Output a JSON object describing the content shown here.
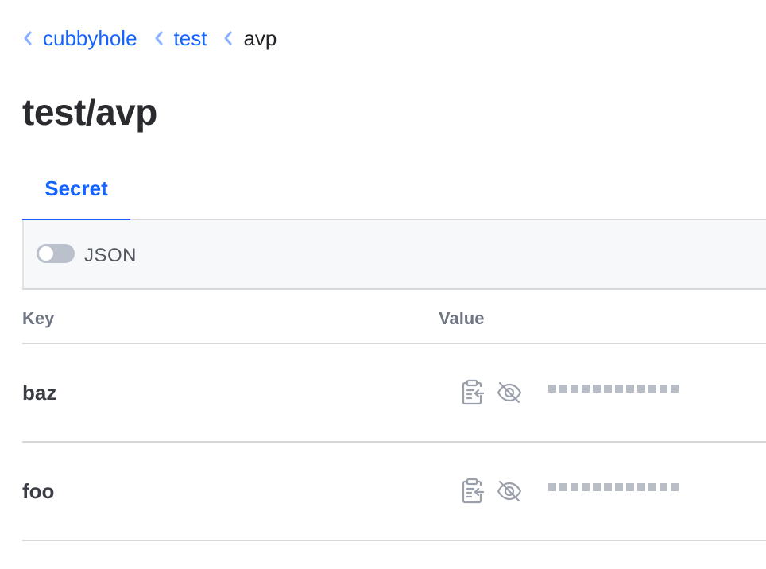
{
  "breadcrumb": {
    "items": [
      {
        "label": "cubbyhole",
        "link": true
      },
      {
        "label": "test",
        "link": true
      },
      {
        "label": "avp",
        "link": false
      }
    ]
  },
  "page": {
    "title": "test/avp"
  },
  "tabs": [
    {
      "label": "Secret",
      "active": true
    }
  ],
  "toolbar": {
    "json_toggle_label": "JSON",
    "json_toggle_on": false
  },
  "table": {
    "headers": {
      "key": "Key",
      "value": "Value"
    },
    "rows": [
      {
        "key": "baz",
        "value_masked": true
      },
      {
        "key": "foo",
        "value_masked": true
      }
    ]
  },
  "icons": {
    "breadcrumb_separator": "chevron-left-icon",
    "copy": "clipboard-copy-icon",
    "reveal": "eye-off-icon"
  },
  "colors": {
    "link": "#1563ff",
    "active_tab": "#1563ff",
    "border": "#d7d8db",
    "muted": "#6f7682",
    "mask": "#b9bdc6"
  }
}
